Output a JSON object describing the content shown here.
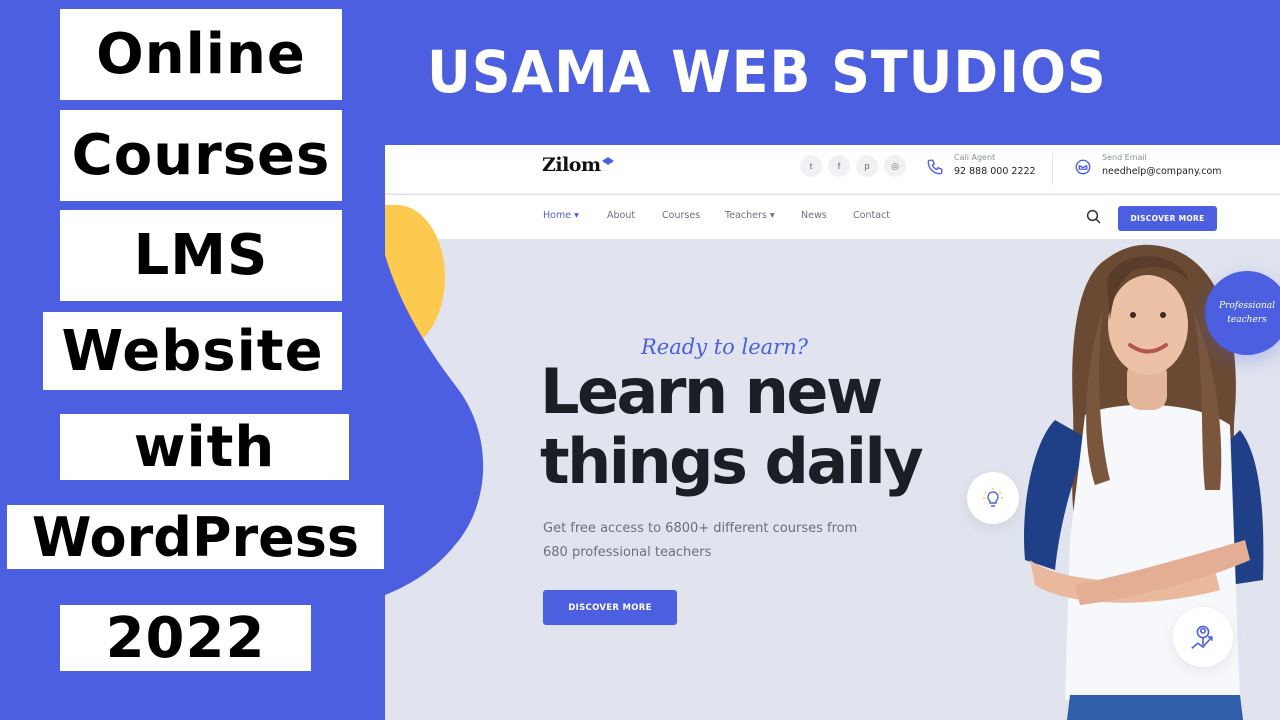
{
  "thumbnail": {
    "title_lines": [
      "Online",
      "Courses",
      "LMS",
      "Website",
      "with",
      "WordPress",
      "2022"
    ],
    "banner_title": "USAMA WEB STUDIOS",
    "colors": {
      "brand_blue": "#4c5fe0",
      "accent_yellow": "#fdc94f",
      "hero_bg": "#e1e4ee"
    }
  },
  "site": {
    "logo": "Zilom",
    "social": [
      {
        "name": "twitter-icon",
        "glyph": "t"
      },
      {
        "name": "facebook-icon",
        "glyph": "f"
      },
      {
        "name": "pinterest-icon",
        "glyph": "p"
      },
      {
        "name": "instagram-icon",
        "glyph": "◎"
      }
    ],
    "contact": {
      "phone_label": "Call Agent",
      "phone": "92 888 000 2222",
      "email_label": "Send Email",
      "email": "needhelp@company.com"
    },
    "nav": {
      "items": [
        "Home ▾",
        "About",
        "Courses",
        "Teachers ▾",
        "News",
        "Contact"
      ],
      "active": "Home",
      "cta": "DISCOVER MORE"
    },
    "hero": {
      "kicker": "Ready to learn?",
      "headline_line1": "Learn new",
      "headline_line2": "things daily",
      "subtitle": "Get free access to 6800+ different courses from 680 professional teachers",
      "cta": "DISCOVER MORE",
      "badge": "Professional teachers"
    }
  }
}
